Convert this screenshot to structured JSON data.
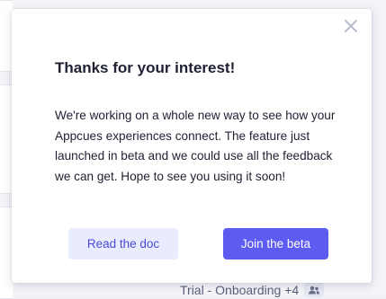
{
  "modal": {
    "title": "Thanks for your interest!",
    "body": "We're working on a whole new way to see how your Appcues experiences connect. The feature just launched in beta and we could use all the feedback we can get. Hope to see you using it soon!",
    "close_icon": "close-icon",
    "secondary_button_label": "Read the doc",
    "primary_button_label": "Join the beta"
  },
  "background": {
    "footer_text": "Trial - Onboarding +4",
    "footer_icon": "users-icon"
  },
  "colors": {
    "primary": "#5c5cf0",
    "secondary_bg": "#e9ebff",
    "secondary_text": "#4a4bd6",
    "title_text": "#1f2033"
  }
}
